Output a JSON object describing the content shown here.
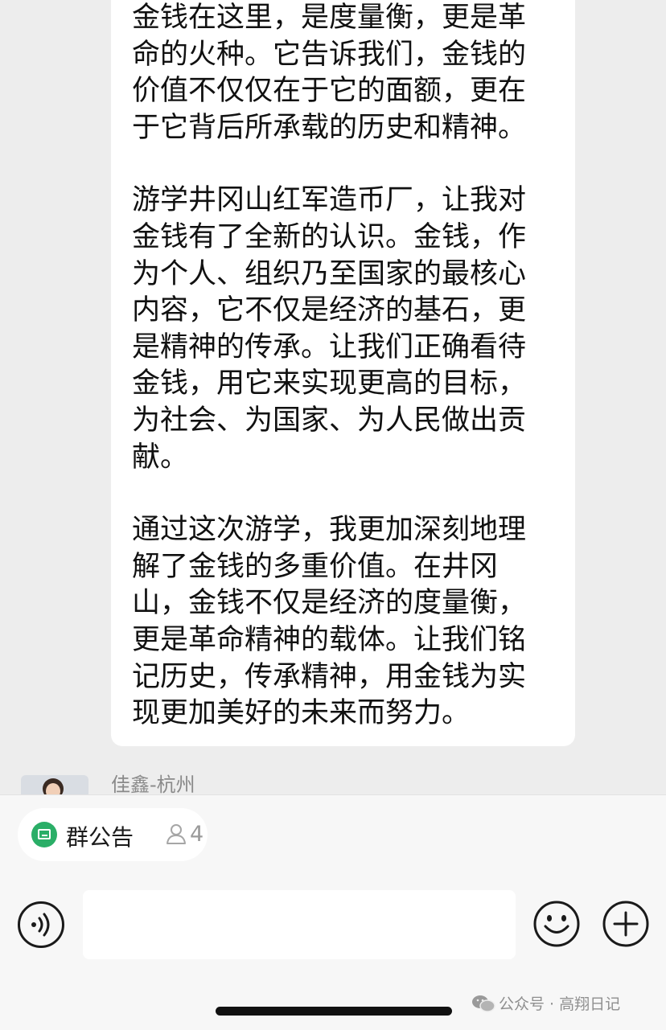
{
  "message": {
    "paragraphs": [
      {
        "lines": [
          " 金钱在这里，是度量衡，更是革",
          "命的火种。它告诉我们，金钱的",
          "价值不仅仅在于它的面额，更在",
          "于它背后所承载的历史和精神。"
        ]
      },
      {
        "lines": [
          " 游学井冈山红军造币厂，让我对",
          "金钱有了全新的认识。金钱，作",
          "为个人、组织乃至国家的最核心",
          "内容，它不仅是经济的基石，更",
          "是精神的传承。让我们正确看待",
          "金钱，用它来实现更高的目标，",
          "为社会、为国家、为人民做出贡",
          "献。"
        ]
      },
      {
        "lines": [
          "通过这次游学，我更加深刻地理",
          "解了金钱的多重价值。在井冈",
          "山，金钱不仅是经济的度量衡，",
          "更是革命精神的载体。让我们铭",
          "记历史，传承精神，用金钱为实",
          "现更加美好的未来而努力。"
        ]
      }
    ]
  },
  "next_message": {
    "sender_name": "佳鑫-杭州"
  },
  "group_announcement": {
    "label": "群公告",
    "member_count": "4",
    "icon": "announcement-icon",
    "icon_color": "#2aae67"
  },
  "input_bar": {
    "placeholder": "",
    "voice_icon": "voice-icon",
    "emoji_icon": "emoji-icon",
    "plus_icon": "plus-icon"
  },
  "watermark": {
    "text": "公众号 · 高翔日记",
    "icon": "wechat-icon"
  },
  "colors": {
    "background": "#ededed",
    "bubble": "#ffffff",
    "panel": "#f7f7f7",
    "accent": "#2aae67"
  }
}
